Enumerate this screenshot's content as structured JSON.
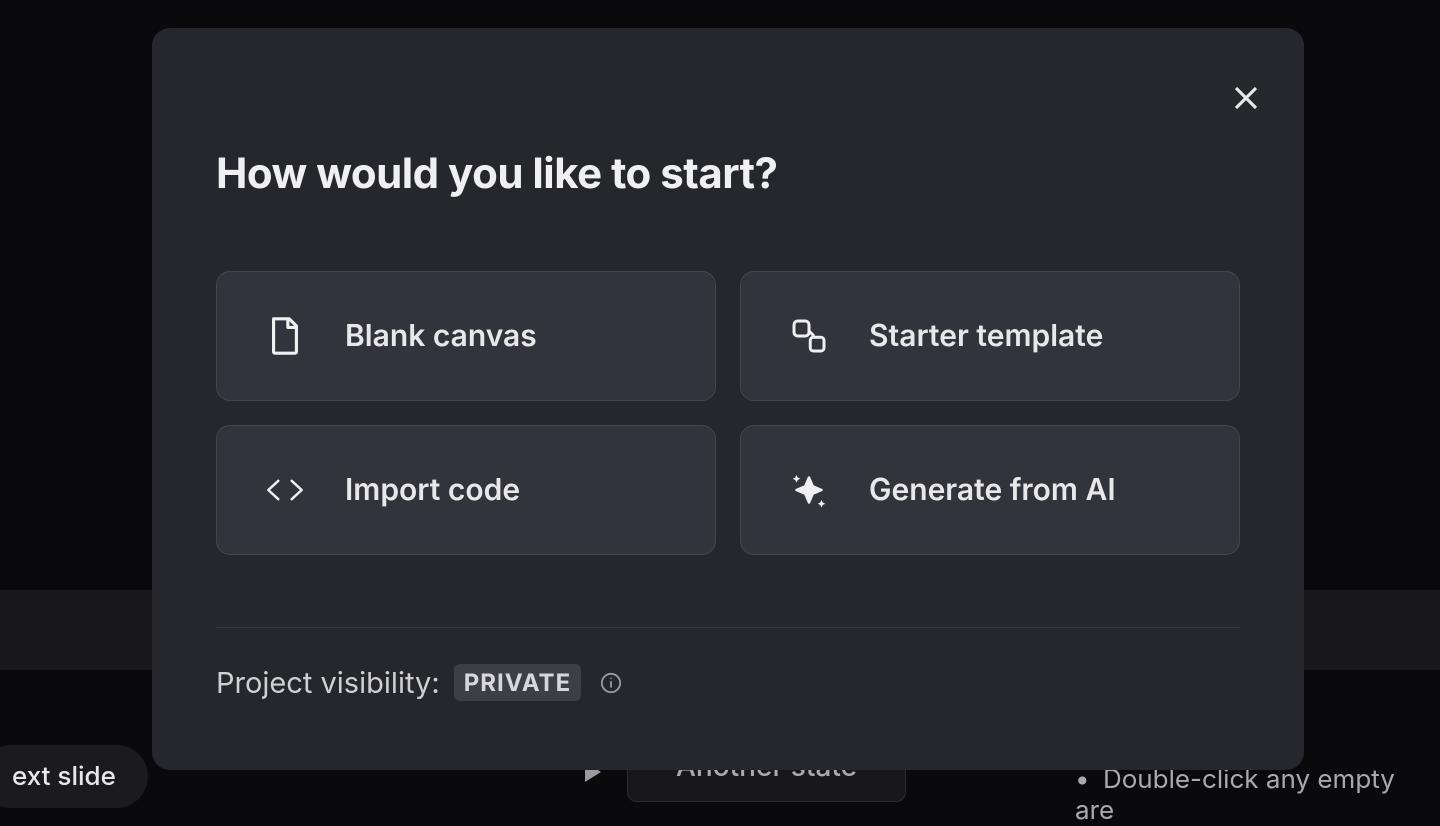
{
  "modal": {
    "title": "How would you like to start?",
    "options": [
      {
        "label": "Blank canvas"
      },
      {
        "label": "Starter template"
      },
      {
        "label": "Import code"
      },
      {
        "label": "Generate from AI"
      }
    ],
    "visibility": {
      "label": "Project visibility:",
      "badge": "PRIVATE"
    }
  },
  "background": {
    "pill": "ext slide",
    "state_box": "Another state",
    "hint": "Double-click any empty are"
  }
}
